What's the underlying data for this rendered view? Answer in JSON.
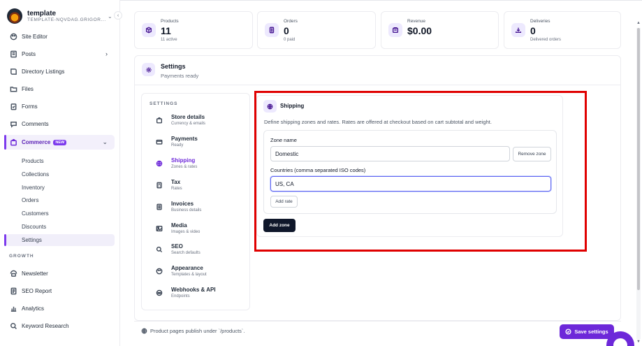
{
  "brand": {
    "title": "template",
    "subtitle": "TEMPLATE-NQVDAG.GRIGOR..."
  },
  "sidebar": {
    "items": [
      {
        "label": "Site Editor",
        "icon": "palette-icon"
      },
      {
        "label": "Posts",
        "icon": "posts-icon"
      },
      {
        "label": "Directory Listings",
        "icon": "book-icon"
      },
      {
        "label": "Files",
        "icon": "folder-icon"
      },
      {
        "label": "Forms",
        "icon": "clipboard-icon"
      },
      {
        "label": "Comments",
        "icon": "comment-icon"
      },
      {
        "label": "Commerce",
        "icon": "shopping-bag-icon",
        "badge": "NEW"
      }
    ],
    "commerce_sub": [
      "Products",
      "Collections",
      "Inventory",
      "Orders",
      "Customers",
      "Discounts",
      "Settings"
    ],
    "growth_label": "GROWTH",
    "growth_items": [
      {
        "label": "Newsletter",
        "icon": "newsletter-icon"
      },
      {
        "label": "SEO Report",
        "icon": "report-icon"
      },
      {
        "label": "Analytics",
        "icon": "analytics-icon"
      },
      {
        "label": "Keyword Research",
        "icon": "search-icon"
      }
    ]
  },
  "stats": [
    {
      "label": "Products",
      "value": "11",
      "sub": "11 active",
      "icon": "box-icon"
    },
    {
      "label": "Orders",
      "value": "0",
      "sub": "0 paid",
      "icon": "receipt-icon"
    },
    {
      "label": "Revenue",
      "value": "$0.00",
      "sub": "",
      "icon": "wallet-icon"
    },
    {
      "label": "Deliveries",
      "value": "0",
      "sub": "Delivered orders",
      "icon": "download-icon"
    }
  ],
  "settings": {
    "title": "Settings",
    "subtitle": "Payments ready",
    "section_label": "SETTINGS",
    "tabs": [
      {
        "name": "Store details",
        "desc": "Currency & emails",
        "icon": "store-icon"
      },
      {
        "name": "Payments",
        "desc": "Ready",
        "icon": "card-icon"
      },
      {
        "name": "Shipping",
        "desc": "Zones & rates",
        "icon": "globe-icon"
      },
      {
        "name": "Tax",
        "desc": "Rates",
        "icon": "calculator-icon"
      },
      {
        "name": "Invoices",
        "desc": "Business details",
        "icon": "invoice-icon"
      },
      {
        "name": "Media",
        "desc": "Images & video",
        "icon": "image-icon"
      },
      {
        "name": "SEO",
        "desc": "Search defaults",
        "icon": "search-icon"
      },
      {
        "name": "Appearance",
        "desc": "Templates & layout",
        "icon": "palette-icon"
      },
      {
        "name": "Webhooks & API",
        "desc": "Endpoints",
        "icon": "webhook-icon"
      }
    ]
  },
  "shipping": {
    "title": "Shipping",
    "description": "Define shipping zones and rates. Rates are offered at checkout based on cart subtotal and weight.",
    "zone_name_label": "Zone name",
    "zone_name_value": "Domestic",
    "remove_zone": "Remove zone",
    "countries_label": "Countries (comma separated ISO codes)",
    "countries_value": "US, CA",
    "add_rate": "Add rate",
    "add_zone": "Add zone"
  },
  "footer": {
    "note": "Product pages publish under `/products`.",
    "save": "Save settings"
  },
  "colors": {
    "accent": "#6d28d9",
    "highlight": "#e00000"
  }
}
